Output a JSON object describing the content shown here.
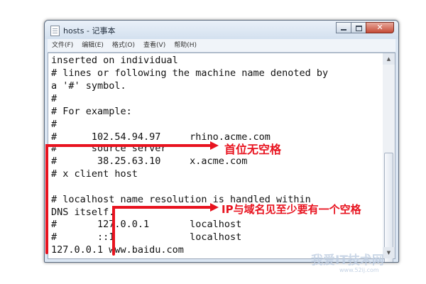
{
  "window": {
    "title": "hosts - 记事本"
  },
  "menu": {
    "items": [
      "文件(F)",
      "编辑(E)",
      "格式(O)",
      "查看(V)",
      "帮助(H)"
    ]
  },
  "editor": {
    "lines": [
      "inserted on individual",
      "# lines or following the machine name denoted by",
      "a '#' symbol.",
      "#",
      "# For example:",
      "#",
      "#      102.54.94.97     rhino.acme.com",
      "#      source server",
      "#       38.25.63.10     x.acme.com",
      "# x client host",
      "",
      "# localhost name resolution is handled within",
      "DNS itself.",
      "#       127.0.0.1       localhost",
      "#       ::1             localhost",
      "127.0.0.1 www.baidu.com"
    ]
  },
  "annotations": {
    "no_space_first": "首位无空格",
    "ip_domain_space": "IP与域名见至少要有一个空格",
    "color": "#e8131f"
  },
  "watermark": {
    "text": "我爱IT技术网",
    "url": "www.52ij.com"
  }
}
